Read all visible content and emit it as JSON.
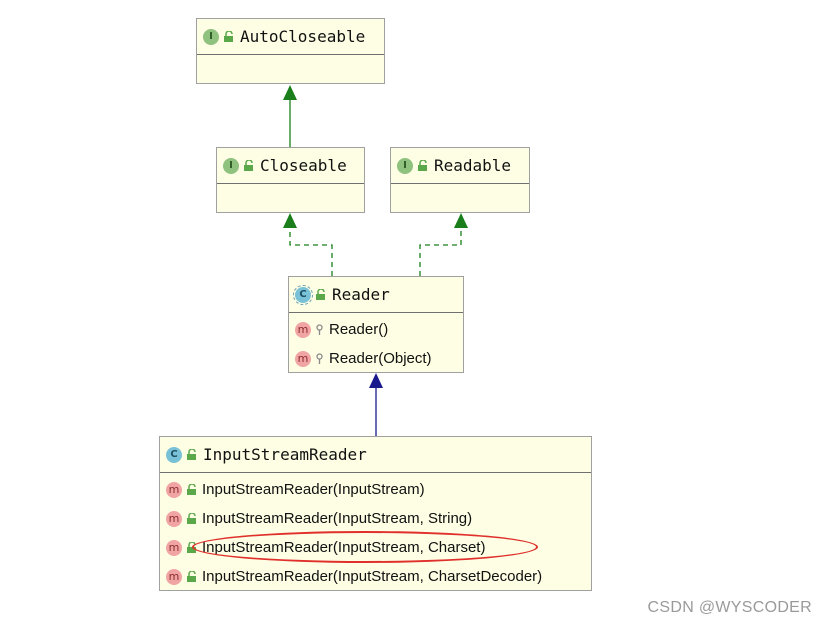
{
  "diagram": {
    "nodes": {
      "autocloseable": {
        "kind": "interface",
        "badge": "I",
        "name": "AutoCloseable",
        "members": []
      },
      "closeable": {
        "kind": "interface",
        "badge": "I",
        "name": "Closeable",
        "members": []
      },
      "readable": {
        "kind": "interface",
        "badge": "I",
        "name": "Readable",
        "members": []
      },
      "reader": {
        "kind": "abstract-class",
        "badge": "C",
        "name": "Reader",
        "members": [
          {
            "badge": "m",
            "visibility": "protected",
            "signature": "Reader()"
          },
          {
            "badge": "m",
            "visibility": "protected",
            "signature": "Reader(Object)"
          }
        ]
      },
      "inputstreamreader": {
        "kind": "class",
        "badge": "C",
        "name": "InputStreamReader",
        "members": [
          {
            "badge": "m",
            "visibility": "public",
            "signature": "InputStreamReader(InputStream)"
          },
          {
            "badge": "m",
            "visibility": "public",
            "signature": "InputStreamReader(InputStream, String)"
          },
          {
            "badge": "m",
            "visibility": "public",
            "signature": "InputStreamReader(InputStream, Charset)",
            "highlighted": true
          },
          {
            "badge": "m",
            "visibility": "public",
            "signature": "InputStreamReader(InputStream, CharsetDecoder)"
          }
        ]
      }
    },
    "edges": [
      {
        "from": "Closeable",
        "to": "AutoCloseable",
        "type": "extends",
        "style": "solid",
        "color": "#1a7f1a"
      },
      {
        "from": "Reader",
        "to": "Closeable",
        "type": "implements",
        "style": "dashed",
        "color": "#1a7f1a"
      },
      {
        "from": "Reader",
        "to": "Readable",
        "type": "implements",
        "style": "dashed",
        "color": "#1a7f1a"
      },
      {
        "from": "InputStreamReader",
        "to": "Reader",
        "type": "extends",
        "style": "solid",
        "color": "#1a1a8c"
      }
    ],
    "colors": {
      "node_fill": "#fefee4",
      "interface_badge": "#8fc17f",
      "class_badge": "#79c1d6",
      "method_badge": "#f1a4a4",
      "highlight": "#e0302c"
    }
  },
  "watermark": "CSDN @WYSCODER"
}
